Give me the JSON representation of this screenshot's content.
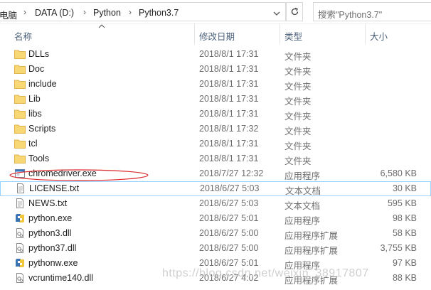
{
  "address_bar": {
    "breadcrumbs": [
      "电脑",
      "DATA (D:)",
      "Python",
      "Python3.7"
    ],
    "search_placeholder": "搜索\"Python3.7\""
  },
  "columns": {
    "name": "名称",
    "date": "修改日期",
    "type": "类型",
    "size": "大小"
  },
  "files": [
    {
      "name": "DLLs",
      "date": "2018/8/1 17:31",
      "type": "文件夹",
      "size": "",
      "icon": "folder-icon"
    },
    {
      "name": "Doc",
      "date": "2018/8/1 17:31",
      "type": "文件夹",
      "size": "",
      "icon": "folder-icon"
    },
    {
      "name": "include",
      "date": "2018/8/1 17:31",
      "type": "文件夹",
      "size": "",
      "icon": "folder-icon"
    },
    {
      "name": "Lib",
      "date": "2018/8/1 17:31",
      "type": "文件夹",
      "size": "",
      "icon": "folder-icon"
    },
    {
      "name": "libs",
      "date": "2018/8/1 17:31",
      "type": "文件夹",
      "size": "",
      "icon": "folder-icon"
    },
    {
      "name": "Scripts",
      "date": "2018/8/1 17:32",
      "type": "文件夹",
      "size": "",
      "icon": "folder-icon"
    },
    {
      "name": "tcl",
      "date": "2018/8/1 17:31",
      "type": "文件夹",
      "size": "",
      "icon": "folder-icon"
    },
    {
      "name": "Tools",
      "date": "2018/8/1 17:31",
      "type": "文件夹",
      "size": "",
      "icon": "folder-icon"
    },
    {
      "name": "chromedriver.exe",
      "date": "2018/7/27 12:32",
      "type": "应用程序",
      "size": "6,580 KB",
      "icon": "exe-icon"
    },
    {
      "name": "LICENSE.txt",
      "date": "2018/6/27 5:03",
      "type": "文本文档",
      "size": "30 KB",
      "icon": "text-file-icon"
    },
    {
      "name": "NEWS.txt",
      "date": "2018/6/27 5:03",
      "type": "文本文档",
      "size": "595 KB",
      "icon": "text-file-icon"
    },
    {
      "name": "python.exe",
      "date": "2018/6/27 5:01",
      "type": "应用程序",
      "size": "98 KB",
      "icon": "python-exe-icon"
    },
    {
      "name": "python3.dll",
      "date": "2018/6/27 5:00",
      "type": "应用程序扩展",
      "size": "58 KB",
      "icon": "dll-icon"
    },
    {
      "name": "python37.dll",
      "date": "2018/6/27 5:00",
      "type": "应用程序扩展",
      "size": "3,755 KB",
      "icon": "dll-icon"
    },
    {
      "name": "pythonw.exe",
      "date": "2018/6/27 5:01",
      "type": "应用程序",
      "size": "97 KB",
      "icon": "python-exe-icon"
    },
    {
      "name": "vcruntime140.dll",
      "date": "2018/6/27 4:02",
      "type": "应用程序扩展",
      "size": "88 KB",
      "icon": "dll-icon"
    }
  ],
  "watermark": "https://blog.csdn.net/weixin_38917807",
  "colors": {
    "folder": "#f8d775",
    "header_text": "#4c607a",
    "annotation": "#d9262a",
    "selection_border": "#99d1ff"
  }
}
